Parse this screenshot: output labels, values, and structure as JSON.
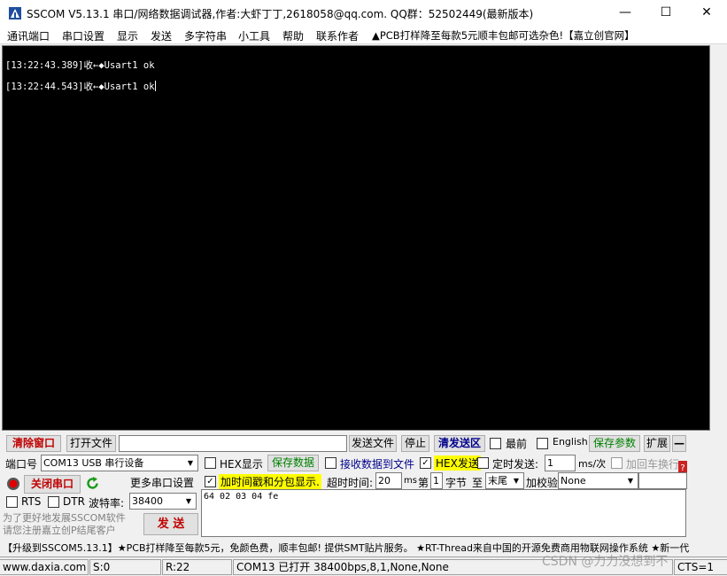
{
  "window": {
    "title": "SSCOM V5.13.1 串口/网络数据调试器,作者:大虾丁丁,2618058@qq.com. QQ群：52502449(最新版本)",
    "minimize": "—",
    "maximize": "☐",
    "close": "✕"
  },
  "menu": {
    "items": [
      "通讯端口",
      "串口设置",
      "显示",
      "发送",
      "多字符串",
      "小工具",
      "帮助",
      "联系作者"
    ],
    "promo": "▲PCB打样降至每款5元顺丰包邮可选杂色!【嘉立创官网】"
  },
  "terminal": {
    "lines": [
      "[13:22:43.389]收←◆Usart1 ok",
      "[13:22:44.543]收←◆Usart1 ok"
    ]
  },
  "row1": {
    "clear_window": "清除窗口",
    "open_file": "打开文件",
    "file_path": "",
    "send_file": "发送文件",
    "stop": "停止",
    "clear_send": "清发送区",
    "topmost": "最前",
    "english": "English",
    "save_params": "保存参数",
    "expand": "扩展",
    "collapse": "—"
  },
  "port": {
    "port_label": "端口号",
    "port_value": "COM13 USB 串行设备",
    "hex_display": "HEX显示",
    "save_data": "保存数据",
    "recv_to_file": "接收数据到文件",
    "hex_send": "HEX发送",
    "timed_send": "定时发送:",
    "interval": "1",
    "interval_unit": "ms/次",
    "add_crlf": "加回车换行",
    "close_port": "关闭串口",
    "more_settings": "更多串口设置",
    "timestamp": "加时间戳和分包显示.",
    "timeout_label": "超时时间:",
    "timeout_value": "20",
    "timeout_unit": "ms",
    "byte_pre": "第",
    "byte_value": "1",
    "byte_label": "字节",
    "to_label": "至",
    "end_value": "末尾",
    "checksum_label": "加校验",
    "checksum_value": "None",
    "rts": "RTS",
    "dtr": "DTR",
    "baud_label": "波特率:",
    "baud_value": "38400",
    "send_data": "64 02 03 04 fe",
    "send_button": "发 送",
    "promo_text": "为了更好地发展SSCOM软件\n请您注册嘉立创P结尾客户"
  },
  "ticker": "【升级到SSCOM5.13.1】★PCB打样降至每款5元，免颜色费，顺丰包邮! 提供SMT贴片服务。 ★RT-Thread来自中国的开源免费商用物联网操作系统 ★新一代",
  "status": {
    "website": "www.daxia.com",
    "sent": "S:0",
    "received": "R:22",
    "port_status": "COM13 已打开  38400bps,8,1,None,None",
    "cts": "CTS=1",
    "watermark": "CSDN @力力没想到不"
  }
}
